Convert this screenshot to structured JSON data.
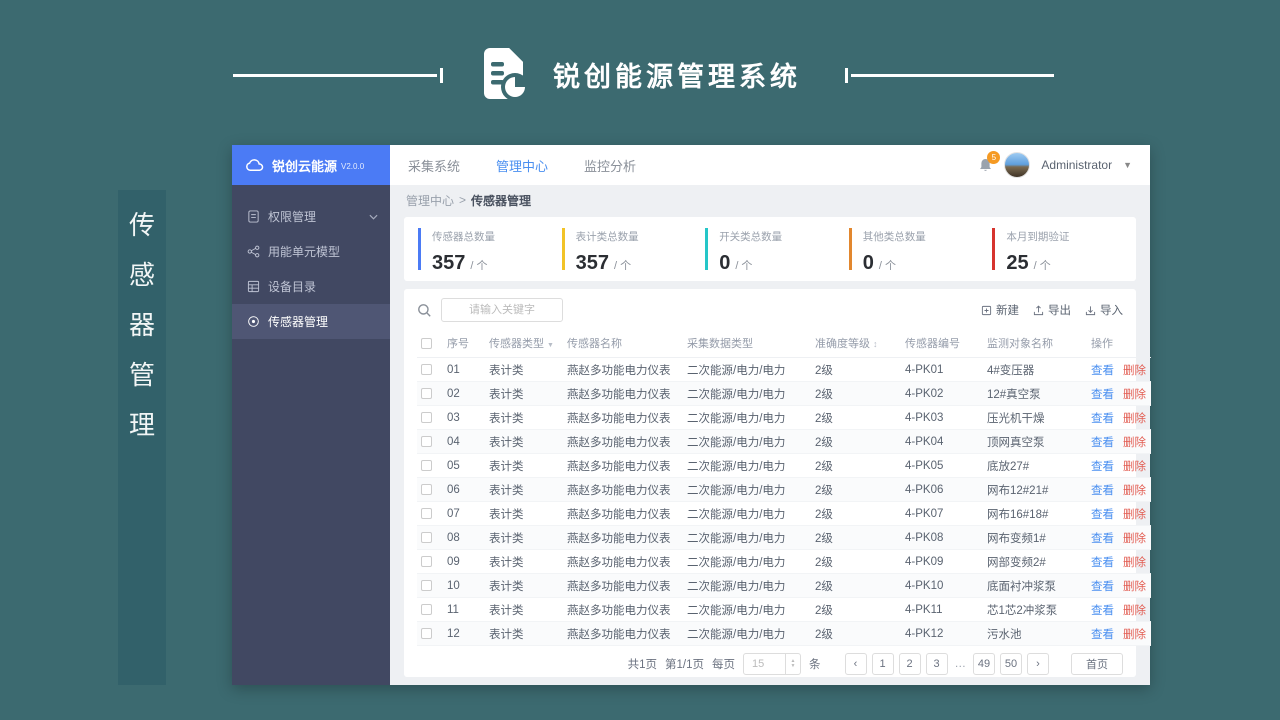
{
  "theme": {
    "page_bg": "#3c6a70",
    "sidebar_bg": "#414862",
    "logo_bg": "#4b7bf5",
    "accent": "#4a8ff0",
    "danger": "#e25b50",
    "badge": "#f59a23"
  },
  "brand": {
    "title": "锐创能源管理系统"
  },
  "side_label": "传感器管理",
  "sidebar": {
    "logo": "锐创云能源",
    "version": "V2.0.0",
    "items": [
      {
        "label": "权限管理",
        "icon": "permissions-icon",
        "expandable": true,
        "active": false
      },
      {
        "label": "用能单元模型",
        "icon": "model-icon",
        "expandable": false,
        "active": false
      },
      {
        "label": "设备目录",
        "icon": "catalog-icon",
        "expandable": false,
        "active": false
      },
      {
        "label": "传感器管理",
        "icon": "sensor-icon",
        "expandable": false,
        "active": true
      }
    ]
  },
  "topnav": {
    "tabs": [
      {
        "label": "采集系统",
        "active": false
      },
      {
        "label": "管理中心",
        "active": true
      },
      {
        "label": "监控分析",
        "active": false
      }
    ],
    "notification_badge": "5",
    "user_name": "Administrator"
  },
  "breadcrumb": {
    "parent": "管理中心",
    "separator": ">",
    "current": "传感器管理"
  },
  "stats": [
    {
      "label": "传感器总数量",
      "value": "357",
      "unit": "/ 个",
      "color": "#4b7bf5"
    },
    {
      "label": "表计类总数量",
      "value": "357",
      "unit": "/ 个",
      "color": "#f2c327"
    },
    {
      "label": "开关类总数量",
      "value": "0",
      "unit": "/ 个",
      "color": "#25c6c8"
    },
    {
      "label": "其他类总数量",
      "value": "0",
      "unit": "/ 个",
      "color": "#e2872e"
    },
    {
      "label": "本月到期验证",
      "value": "25",
      "unit": "/ 个",
      "color": "#d6342e"
    }
  ],
  "toolbar": {
    "search_placeholder": "请输入关键字",
    "actions": [
      {
        "label": "新建",
        "icon": "new-icon"
      },
      {
        "label": "导出",
        "icon": "export-icon"
      },
      {
        "label": "导入",
        "icon": "import-icon"
      }
    ]
  },
  "table": {
    "columns": [
      {
        "label": "序号",
        "icon": null
      },
      {
        "label": "传感器类型",
        "icon": "filter"
      },
      {
        "label": "传感器名称",
        "icon": null
      },
      {
        "label": "采集数据类型",
        "icon": null
      },
      {
        "label": "准确度等级",
        "icon": "sort"
      },
      {
        "label": "传感器编号",
        "icon": null
      },
      {
        "label": "监测对象名称",
        "icon": null
      },
      {
        "label": "操作",
        "icon": null
      }
    ],
    "actions": {
      "view": "查看",
      "delete": "删除"
    },
    "rows": [
      {
        "no": "01",
        "type": "表计类",
        "name": "燕赵多功能电力仪表",
        "data_type": "二次能源/电力/电力",
        "accuracy": "2级",
        "code": "4-PK01",
        "target": "4#变压器"
      },
      {
        "no": "02",
        "type": "表计类",
        "name": "燕赵多功能电力仪表",
        "data_type": "二次能源/电力/电力",
        "accuracy": "2级",
        "code": "4-PK02",
        "target": "12#真空泵"
      },
      {
        "no": "03",
        "type": "表计类",
        "name": "燕赵多功能电力仪表",
        "data_type": "二次能源/电力/电力",
        "accuracy": "2级",
        "code": "4-PK03",
        "target": "压光机干燥"
      },
      {
        "no": "04",
        "type": "表计类",
        "name": "燕赵多功能电力仪表",
        "data_type": "二次能源/电力/电力",
        "accuracy": "2级",
        "code": "4-PK04",
        "target": "顶网真空泵"
      },
      {
        "no": "05",
        "type": "表计类",
        "name": "燕赵多功能电力仪表",
        "data_type": "二次能源/电力/电力",
        "accuracy": "2级",
        "code": "4-PK05",
        "target": "底放27#"
      },
      {
        "no": "06",
        "type": "表计类",
        "name": "燕赵多功能电力仪表",
        "data_type": "二次能源/电力/电力",
        "accuracy": "2级",
        "code": "4-PK06",
        "target": "网布12#21#"
      },
      {
        "no": "07",
        "type": "表计类",
        "name": "燕赵多功能电力仪表",
        "data_type": "二次能源/电力/电力",
        "accuracy": "2级",
        "code": "4-PK07",
        "target": "网布16#18#"
      },
      {
        "no": "08",
        "type": "表计类",
        "name": "燕赵多功能电力仪表",
        "data_type": "二次能源/电力/电力",
        "accuracy": "2级",
        "code": "4-PK08",
        "target": "网布变频1#"
      },
      {
        "no": "09",
        "type": "表计类",
        "name": "燕赵多功能电力仪表",
        "data_type": "二次能源/电力/电力",
        "accuracy": "2级",
        "code": "4-PK09",
        "target": "网部变频2#"
      },
      {
        "no": "10",
        "type": "表计类",
        "name": "燕赵多功能电力仪表",
        "data_type": "二次能源/电力/电力",
        "accuracy": "2级",
        "code": "4-PK10",
        "target": "底面衬冲浆泵"
      },
      {
        "no": "11",
        "type": "表计类",
        "name": "燕赵多功能电力仪表",
        "data_type": "二次能源/电力/电力",
        "accuracy": "2级",
        "code": "4-PK11",
        "target": "芯1芯2冲浆泵"
      },
      {
        "no": "12",
        "type": "表计类",
        "name": "燕赵多功能电力仪表",
        "data_type": "二次能源/电力/电力",
        "accuracy": "2级",
        "code": "4-PK12",
        "target": "污水池"
      }
    ]
  },
  "pagination": {
    "total_pages": "共1页",
    "current": "第1/1页",
    "per_page_label": "每页",
    "per_page_value": "15",
    "unit_label": "条",
    "pages": [
      "1",
      "2",
      "3",
      "…",
      "49",
      "50"
    ],
    "first_label": "首页"
  }
}
